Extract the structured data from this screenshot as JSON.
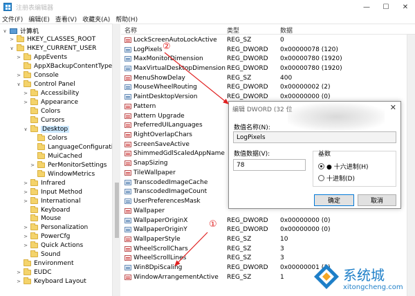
{
  "window": {
    "title": "注册表编辑器",
    "controls": [
      "—",
      "☐",
      "✕"
    ]
  },
  "menu": [
    "文件(F)",
    "编辑(E)",
    "查看(V)",
    "收藏夹(A)",
    "帮助(H)"
  ],
  "tree": [
    {
      "label": "计算机",
      "exp": "∨",
      "icon": "pc",
      "indent": 0
    },
    {
      "label": "HKEY_CLASSES_ROOT",
      "exp": ">",
      "icon": "folder",
      "indent": 1
    },
    {
      "label": "HKEY_CURRENT_USER",
      "exp": "∨",
      "icon": "folder",
      "indent": 1
    },
    {
      "label": "AppEvents",
      "exp": ">",
      "icon": "folder",
      "indent": 2
    },
    {
      "label": "AppXBackupContentType",
      "exp": "",
      "icon": "folder",
      "indent": 2
    },
    {
      "label": "Console",
      "exp": ">",
      "icon": "folder",
      "indent": 2
    },
    {
      "label": "Control Panel",
      "exp": "∨",
      "icon": "folder",
      "indent": 2
    },
    {
      "label": "Accessibility",
      "exp": ">",
      "icon": "folder",
      "indent": 3
    },
    {
      "label": "Appearance",
      "exp": ">",
      "icon": "folder",
      "indent": 3
    },
    {
      "label": "Colors",
      "exp": "",
      "icon": "folder",
      "indent": 3
    },
    {
      "label": "Cursors",
      "exp": "",
      "icon": "folder",
      "indent": 3
    },
    {
      "label": "Desktop",
      "exp": "∨",
      "icon": "folder",
      "indent": 3,
      "selected": true
    },
    {
      "label": "Colors",
      "exp": "",
      "icon": "folder",
      "indent": 4
    },
    {
      "label": "LanguageConfiguratio",
      "exp": "",
      "icon": "folder",
      "indent": 4
    },
    {
      "label": "MuiCached",
      "exp": "",
      "icon": "folder",
      "indent": 4
    },
    {
      "label": "PerMonitorSettings",
      "exp": ">",
      "icon": "folder",
      "indent": 4
    },
    {
      "label": "WindowMetrics",
      "exp": "",
      "icon": "folder",
      "indent": 4
    },
    {
      "label": "Infrared",
      "exp": ">",
      "icon": "folder",
      "indent": 3
    },
    {
      "label": "Input Method",
      "exp": ">",
      "icon": "folder",
      "indent": 3
    },
    {
      "label": "International",
      "exp": ">",
      "icon": "folder",
      "indent": 3
    },
    {
      "label": "Keyboard",
      "exp": "",
      "icon": "folder",
      "indent": 3
    },
    {
      "label": "Mouse",
      "exp": "",
      "icon": "folder",
      "indent": 3
    },
    {
      "label": "Personalization",
      "exp": ">",
      "icon": "folder",
      "indent": 3
    },
    {
      "label": "PowerCfg",
      "exp": ">",
      "icon": "folder",
      "indent": 3
    },
    {
      "label": "Quick Actions",
      "exp": ">",
      "icon": "folder",
      "indent": 3
    },
    {
      "label": "Sound",
      "exp": "",
      "icon": "folder",
      "indent": 3
    },
    {
      "label": "Environment",
      "exp": "",
      "icon": "folder",
      "indent": 2
    },
    {
      "label": "EUDC",
      "exp": ">",
      "icon": "folder",
      "indent": 2
    },
    {
      "label": "Keyboard Layout",
      "exp": ">",
      "icon": "folder",
      "indent": 2
    }
  ],
  "columns": {
    "name": "名称",
    "type": "类型",
    "data": "数据"
  },
  "values": [
    {
      "name": "LockScreenAutoLockActive",
      "type": "REG_SZ",
      "data": "0",
      "kind": "sz"
    },
    {
      "name": "LogPixels",
      "type": "REG_DWORD",
      "data": "0x00000078 (120)",
      "kind": "dword"
    },
    {
      "name": "MaxMonitorDimension",
      "type": "REG_DWORD",
      "data": "0x00000780 (1920)",
      "kind": "dword"
    },
    {
      "name": "MaxVirtualDesktopDimension",
      "type": "REG_DWORD",
      "data": "0x00000780 (1920)",
      "kind": "dword"
    },
    {
      "name": "MenuShowDelay",
      "type": "REG_SZ",
      "data": "400",
      "kind": "sz"
    },
    {
      "name": "MouseWheelRouting",
      "type": "REG_DWORD",
      "data": "0x00000002 (2)",
      "kind": "dword"
    },
    {
      "name": "PaintDesktopVersion",
      "type": "REG_DWORD",
      "data": "0x00000000 (0)",
      "kind": "dword"
    },
    {
      "name": "Pattern",
      "type": "",
      "data": "",
      "kind": "sz"
    },
    {
      "name": "Pattern Upgrade",
      "type": "",
      "data": "",
      "kind": "sz"
    },
    {
      "name": "PreferredUILanguages",
      "type": "",
      "data": "",
      "kind": "sz"
    },
    {
      "name": "RightOverlapChars",
      "type": "",
      "data": "",
      "kind": "sz"
    },
    {
      "name": "ScreenSaveActive",
      "type": "",
      "data": "",
      "kind": "sz"
    },
    {
      "name": "ShimmedGdlScaledAppName",
      "type": "",
      "data": "",
      "kind": "sz"
    },
    {
      "name": "SnapSizing",
      "type": "",
      "data": "",
      "kind": "sz"
    },
    {
      "name": "TileWallpaper",
      "type": "",
      "data": "",
      "kind": "sz"
    },
    {
      "name": "TranscodedImageCache",
      "type": "",
      "data": "",
      "kind": "dword"
    },
    {
      "name": "TranscodedImageCount",
      "type": "",
      "data": "",
      "kind": "dword"
    },
    {
      "name": "UserPreferencesMask",
      "type": "",
      "data": "",
      "kind": "dword"
    },
    {
      "name": "Wallpaper",
      "type": "",
      "data": "",
      "kind": "sz"
    },
    {
      "name": "WallpaperOriginX",
      "type": "REG_DWORD",
      "data": "0x00000000 (0)",
      "kind": "dword"
    },
    {
      "name": "WallpaperOriginY",
      "type": "REG_DWORD",
      "data": "0x00000000 (0)",
      "kind": "dword"
    },
    {
      "name": "WallpaperStyle",
      "type": "REG_SZ",
      "data": "10",
      "kind": "sz"
    },
    {
      "name": "WheelScrollChars",
      "type": "REG_SZ",
      "data": "3",
      "kind": "sz"
    },
    {
      "name": "WheelScrollLines",
      "type": "REG_SZ",
      "data": "3",
      "kind": "sz"
    },
    {
      "name": "Win8DpiScaling",
      "type": "REG_DWORD",
      "data": "0x00000001 (1)",
      "kind": "dword"
    },
    {
      "name": "WindowArrangementActive",
      "type": "REG_SZ",
      "data": "1",
      "kind": "sz"
    }
  ],
  "dialog": {
    "title": "编辑 DWORD (32 位",
    "close": "✕",
    "name_label": "数值名称(N):",
    "name_value": "LogPixels",
    "data_label": "数值数据(V):",
    "data_value": "78",
    "base_label": "基数",
    "hex_label": "● 十六进制(H)",
    "dec_label": "十进制(D)",
    "ok": "确定",
    "cancel": "取消"
  },
  "annotations": {
    "one": "①",
    "two": "②",
    "color": "#e02020"
  },
  "watermark": {
    "cn": "系统城",
    "en": "xitongcheng.com"
  }
}
